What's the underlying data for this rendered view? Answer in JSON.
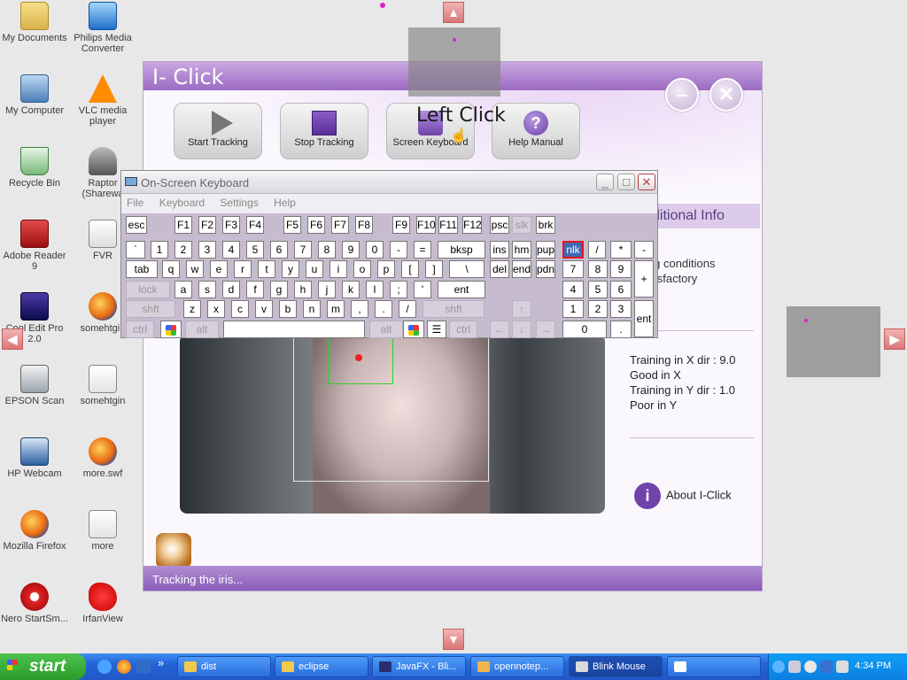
{
  "desktop": {
    "icons_col1": [
      {
        "label": "My Documents",
        "icon": "folder"
      },
      {
        "label": "My Computer",
        "icon": "pc"
      },
      {
        "label": "Recycle Bin",
        "icon": "bin"
      },
      {
        "label": "Adobe Reader 9",
        "icon": "pdf"
      },
      {
        "label": "Cool Edit Pro 2.0",
        "icon": "cool"
      },
      {
        "label": "EPSON Scan",
        "icon": "epson"
      },
      {
        "label": "HP Webcam",
        "icon": "webcam"
      },
      {
        "label": "Mozilla Firefox",
        "icon": "firefox"
      },
      {
        "label": "Nero StartSm...",
        "icon": "nero"
      }
    ],
    "icons_col2": [
      {
        "label": "Philips Media Converter",
        "icon": "philips"
      },
      {
        "label": "VLC media player",
        "icon": "vlc"
      },
      {
        "label": "Raptor (Sharewa",
        "icon": "raptor"
      },
      {
        "label": "FVR",
        "icon": "fvr"
      },
      {
        "label": "somehtgin",
        "icon": "firefox"
      },
      {
        "label": "somehtgin",
        "icon": "doc"
      },
      {
        "label": "more.swf",
        "icon": "firefox"
      },
      {
        "label": "more",
        "icon": "doc"
      },
      {
        "label": "IrfanView",
        "icon": "irfan"
      }
    ]
  },
  "iclick": {
    "title": "I- Click",
    "toolbar": [
      {
        "label": "Start Tracking",
        "icon": "play-icon"
      },
      {
        "label": "Stop Tracking",
        "icon": "stop-icon"
      },
      {
        "label": "Screen Keyboard",
        "icon": "keyboard-icon"
      },
      {
        "label": "Help Manual",
        "icon": "help-icon"
      }
    ],
    "overlay_text": "Left Click",
    "panel_tab": "ditional Info",
    "conditions": [
      "ing conditions",
      "atisfactory"
    ],
    "training": [
      "Training in X dir : 9.0",
      "Good in X",
      "Training in Y dir : 1.0",
      "Poor in Y"
    ],
    "about_label": "About I-Click",
    "status": "Tracking the iris..."
  },
  "osk": {
    "title": "On-Screen Keyboard",
    "menu": [
      "File",
      "Keyboard",
      "Settings",
      "Help"
    ],
    "window_buttons": {
      "minimize": "_",
      "maximize": "□",
      "close": "✕"
    },
    "keys": {
      "row0": [
        "esc",
        "F1",
        "F2",
        "F3",
        "F4",
        "F5",
        "F6",
        "F7",
        "F8",
        "F9",
        "F10",
        "F11",
        "F12",
        "psc",
        "slk",
        "brk"
      ],
      "row1": [
        "`",
        "1",
        "2",
        "3",
        "4",
        "5",
        "6",
        "7",
        "8",
        "9",
        "0",
        "-",
        "=",
        "bksp",
        "ins",
        "hm",
        "pup",
        "nlk",
        "/",
        "*",
        "-"
      ],
      "row2": [
        "tab",
        "q",
        "w",
        "e",
        "r",
        "t",
        "y",
        "u",
        "i",
        "o",
        "p",
        "[",
        "]",
        "\\",
        "del",
        "end",
        "pdn",
        "7",
        "8",
        "9",
        "+"
      ],
      "row3": [
        "lock",
        "a",
        "s",
        "d",
        "f",
        "g",
        "h",
        "j",
        "k",
        "l",
        ";",
        "'",
        "ent",
        "4",
        "5",
        "6"
      ],
      "row4": [
        "shft",
        "z",
        "x",
        "c",
        "v",
        "b",
        "n",
        "m",
        ",",
        ".",
        "/",
        "shft",
        "↑",
        "1",
        "2",
        "3",
        "ent"
      ],
      "row5": [
        "ctrl",
        "alt",
        "alt",
        "ctrl",
        "←",
        "↓",
        "→",
        "0",
        "."
      ]
    },
    "active_key": "nlk"
  },
  "taskbar": {
    "start_label": "start",
    "items": [
      {
        "label": "dist",
        "icon": "folder-icon",
        "color": "#f2c94c"
      },
      {
        "label": "eclipse",
        "icon": "folder-icon",
        "color": "#f2c94c"
      },
      {
        "label": "JavaFX - Bli...",
        "icon": "eclipse-icon",
        "color": "#2b2d6e"
      },
      {
        "label": "opennotep...",
        "icon": "app-icon",
        "color": "#f2b44c"
      },
      {
        "label": "Blink Mouse",
        "icon": "window-icon",
        "color": "#d9d9d9",
        "active": true
      },
      {
        "label": "",
        "icon": "java-icon",
        "color": "#ffffff"
      }
    ],
    "clock": "4:34 PM"
  },
  "colors": {
    "accent_purple": "#9c6bc4",
    "taskbar_blue": "#2463d6",
    "start_green": "#2b9b2b"
  }
}
